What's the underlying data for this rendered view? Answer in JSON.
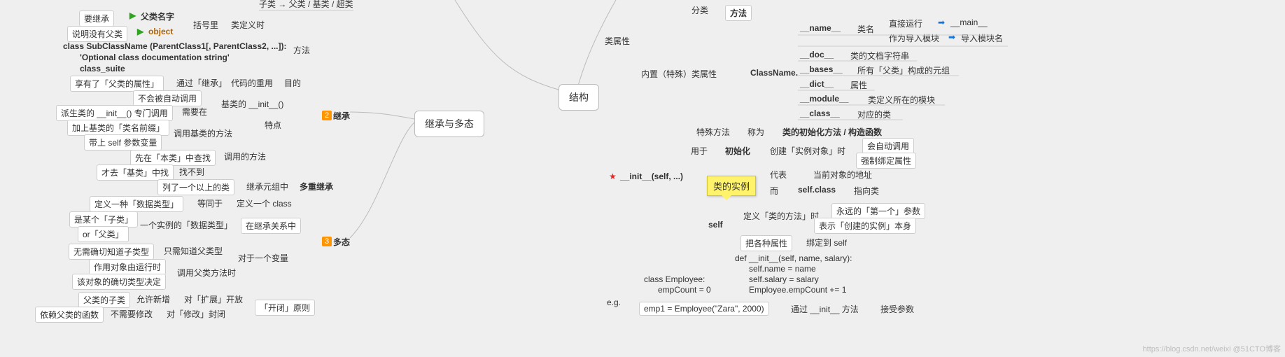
{
  "watermark": "https://blog.csdn.net/weixi @51CTO博客",
  "left": {
    "top_partial": "子类 → 父类 / 基类 / 超类",
    "inherit_lbl": "要继承",
    "parent_name": "父类名字",
    "noparent_lbl": "说明没有父类",
    "object_lbl": "object",
    "code1": "class SubClassName (ParentClass1[, ParentClass2, ...]):",
    "code2": "'Optional class documentation string'",
    "code3": "class_suite",
    "bracket": "括号里",
    "classdef_time": "类定义时",
    "method": "方法",
    "has_parent_attr": "享有了「父类的属性」",
    "via_inherit": "通过「继承」",
    "code_reuse": "代码的重用",
    "purpose": "目的",
    "inh_num": "2",
    "inh_title": "继承",
    "not_autocall": "不会被自动调用",
    "derived_init": "派生类的 __init__() 专门调用",
    "need_in": "需要在",
    "base_init": "基类的 __init__()",
    "add_base_prefix": "加上基类的「类名前缀」",
    "with_self": "带上 self 参数变量",
    "call_base_method": "调用基类的方法",
    "feature": "特点",
    "call_method": "调用的方法",
    "first_self": "先在「本类」中查找",
    "then_base": "才去「基类」中找",
    "not_found": "找不到",
    "list_multi": "列了一个以上的类",
    "in_tuple": "继承元组中",
    "multi_inh": "多重继承",
    "poly_num": "3",
    "poly_title": "多态",
    "define_type": "定义一种「数据类型」",
    "equiv": "等同于",
    "define_class": "定义一个 class",
    "is_sub": "是某个「子类」",
    "or_parent": "or「父类」",
    "one_instance_type": "一个实例的「数据类型」",
    "in_inh_rel": "在继承关系中",
    "no_need_sub": "无需确切知道子类型",
    "only_know_parent": "只需知道父类型",
    "for_one_var": "对于一个变量",
    "act_on_runtime": "作用对象由运行时",
    "exact_type": "该对象的确切类型决定",
    "call_parent_method": "调用父类方法时",
    "sub_of_parent": "父类的子类",
    "allow_add": "允许新增",
    "ext_open": "对「扩展」开放",
    "rely_parent_fn": "依赖父类的函数",
    "no_need_mod": "不需要修改",
    "mod_close": "对「修改」封闭",
    "open_close": "「开闭」原则"
  },
  "center": {
    "inh_poly": "继承与多态",
    "struct": "结构"
  },
  "right": {
    "cat": "分类",
    "method": "方法",
    "class_attr": "类属性",
    "builtin_attr": "内置（特殊）类属性",
    "classname_dot": "ClassName.",
    "name_attr": "__name__",
    "name_desc": "类名",
    "direct_run": "直接运行",
    "main": "__main__",
    "as_import": "作为导入模块",
    "import_name": "导入模块名",
    "doc_attr": "__doc__",
    "doc_desc": "类的文档字符串",
    "bases_attr": "__bases__",
    "bases_desc": "所有「父类」构成的元组",
    "dict_attr": "__dict__",
    "dict_desc": "属性",
    "module_attr": "__module__",
    "module_desc": "类定义所在的模块",
    "class_attr2": "__class__",
    "class_desc": "对应的类",
    "special_method": "特殊方法",
    "called": "称为",
    "init_method": "类的初始化方法 / 构造函数",
    "used_for": "用于",
    "initialize": "初始化",
    "create_inst": "创建「实例对象」时",
    "auto_call": "会自动调用",
    "force_bind": "强制绑定属性",
    "init_sig": "__init__(self, ...)",
    "tooltip": "类的实例",
    "represent": "代表",
    "addr": "当前对象的地址",
    "while": "而",
    "selfclass": "self.class",
    "point_class": "指向类",
    "self": "self",
    "define_method": "定义「类的方法」时",
    "always_first": "永远的「第一个」参数",
    "indicate_inst": "表示「创建的实例」本身",
    "bind_attrs": "把各种属性",
    "bind_to_self": "绑定到 self",
    "eg": "e.g.",
    "code_a1": "class Employee:",
    "code_a2": "empCount = 0",
    "code_b1": "def __init__(self, name, salary):",
    "code_b2": "self.name = name",
    "code_b3": "self.salary = salary",
    "code_b4": "Employee.empCount += 1",
    "emp1": "emp1 = Employee(\"Zara\", 2000)",
    "via_init": "通过 __init__ 方法",
    "accept_args": "接受参数"
  }
}
